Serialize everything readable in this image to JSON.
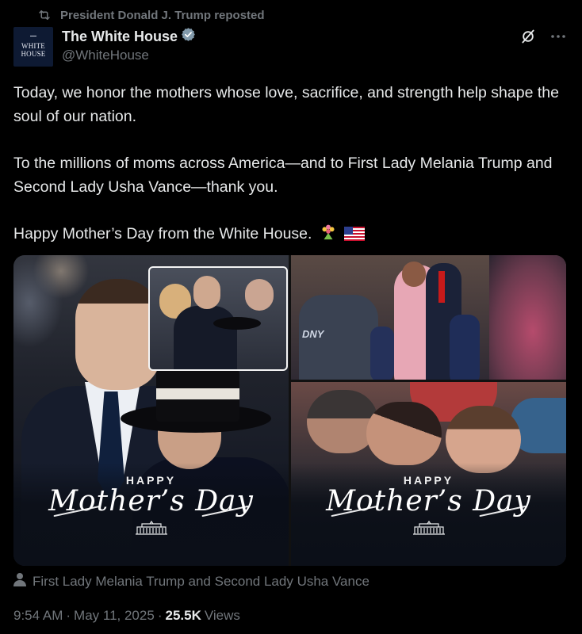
{
  "repost": {
    "text": "President Donald J. Trump reposted",
    "icon": "repost-icon"
  },
  "author": {
    "name": "The White House",
    "handle": "@WhiteHouse",
    "verified_color": "#829aab",
    "avatar_text_line1": "WHITE",
    "avatar_text_line2": "HOUSE"
  },
  "tweet": {
    "paragraph1": "Today, we honor the mothers whose love, sacrifice, and strength help shape the soul of our nation.",
    "paragraph2": "To the millions of moms across America—and to First Lady Melania Trump and Second Lady Usha Vance—thank you.",
    "paragraph3": "Happy Mother’s Day from the White House."
  },
  "media": {
    "left_overlay": {
      "happy": "HAPPY",
      "mothers_day": "Mother’s Day"
    },
    "right_overlay": {
      "happy": "HAPPY",
      "mothers_day": "Mother’s Day"
    },
    "left_inset_label": "",
    "right_top_label": "DNY"
  },
  "caption": {
    "text": "First Lady Melania Trump and Second Lady Usha Vance",
    "icon": "person-icon"
  },
  "meta": {
    "time": "9:54 AM",
    "sep1": "·",
    "date": "May 11, 2025",
    "sep2": "·",
    "views_count": "25.5K",
    "views_label": "Views"
  }
}
